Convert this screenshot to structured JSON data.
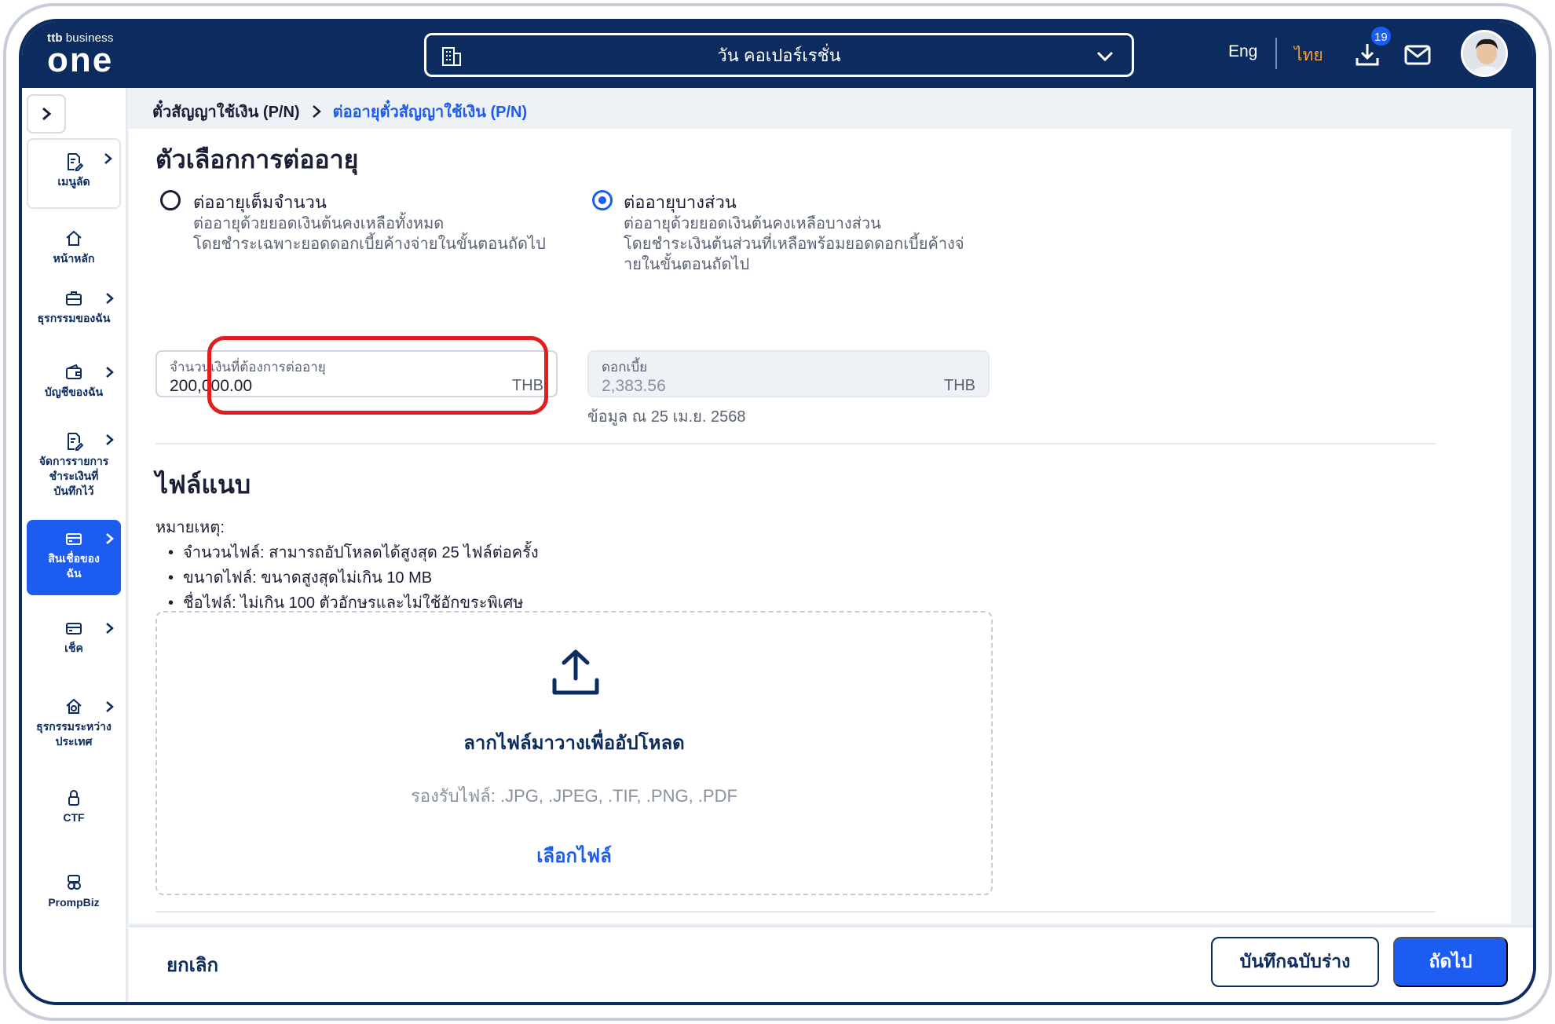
{
  "header": {
    "brand_small_prefix": "ttb",
    "brand_small": "business",
    "brand_big": "one",
    "company": "วัน คอเปอร์เรชั่น",
    "lang_en": "Eng",
    "lang_th": "ไทย",
    "download_badge": "19"
  },
  "sidebar": {
    "items": [
      {
        "label": "เมนูลัด"
      },
      {
        "label": "หน้าหลัก"
      },
      {
        "label": "ธุรกรรมของฉัน"
      },
      {
        "label": "บัญชีของฉัน"
      },
      {
        "label": "จัดการรายการชำระเงินที่บันทึกไว้"
      },
      {
        "label": "สินเชื่อของฉัน"
      },
      {
        "label": "เช็ค"
      },
      {
        "label": "ธุรกรรมระหว่างประเทศ"
      },
      {
        "label": "CTF"
      },
      {
        "label": "PrompBiz"
      }
    ]
  },
  "breadcrumb": {
    "parent": "ตั๋วสัญญาใช้เงิน (P/N)",
    "current": "ต่ออายุตั๋วสัญญาใช้เงิน (P/N)"
  },
  "renewal": {
    "title": "ตัวเลือกการต่ออายุ",
    "full": {
      "label": "ต่ออายุเต็มจำนวน",
      "desc1": "ต่ออายุด้วยยอดเงินต้นคงเหลือทั้งหมด",
      "desc2": "โดยชำระเฉพาะยอดดอกเบี้ยค้างจ่ายในขั้นตอนถัดไป"
    },
    "partial": {
      "label": "ต่ออายุบางส่วน",
      "desc1": "ต่ออายุด้วยยอดเงินต้นคงเหลือบางส่วน",
      "desc2": "โดยชำระเงินต้นส่วนที่เหลือพร้อมยอดดอกเบี้ยค้างจ่",
      "desc3": "ายในขั้นตอนถัดไป"
    },
    "amount": {
      "label": "จำนวนเงินที่ต้องการต่ออายุ",
      "value": "200,000.00",
      "unit": "THB"
    },
    "interest": {
      "label": "ดอกเบี้ย",
      "value": "2,383.56",
      "unit": "THB"
    },
    "as_of": "ข้อมูล ณ 25 เม.ย. 2568"
  },
  "attachments": {
    "title": "ไฟล์แนบ",
    "note_title": "หมายเหตุ:",
    "notes": [
      "จำนวนไฟล์: สามารถอัปโหลดได้สูงสุด 25 ไฟล์ต่อครั้ง",
      "ขนาดไฟล์: ขนาดสูงสุดไม่เกิน 10 MB",
      "ชื่อไฟล์: ไม่เกิน 100 ตัวอักษรและไม่ใช้อักขระพิเศษ"
    ],
    "drop_title": "ลากไฟล์มาวางเพื่ออัปโหลด",
    "drop_formats": "รองรับไฟล์: .JPG, .JPEG, .TIF, .PNG, .PDF",
    "choose_file": "เลือกไฟล์"
  },
  "footer": {
    "cancel": "ยกเลิก",
    "save_draft": "บันทึกฉบับร่าง",
    "next": "ถัดไป"
  }
}
